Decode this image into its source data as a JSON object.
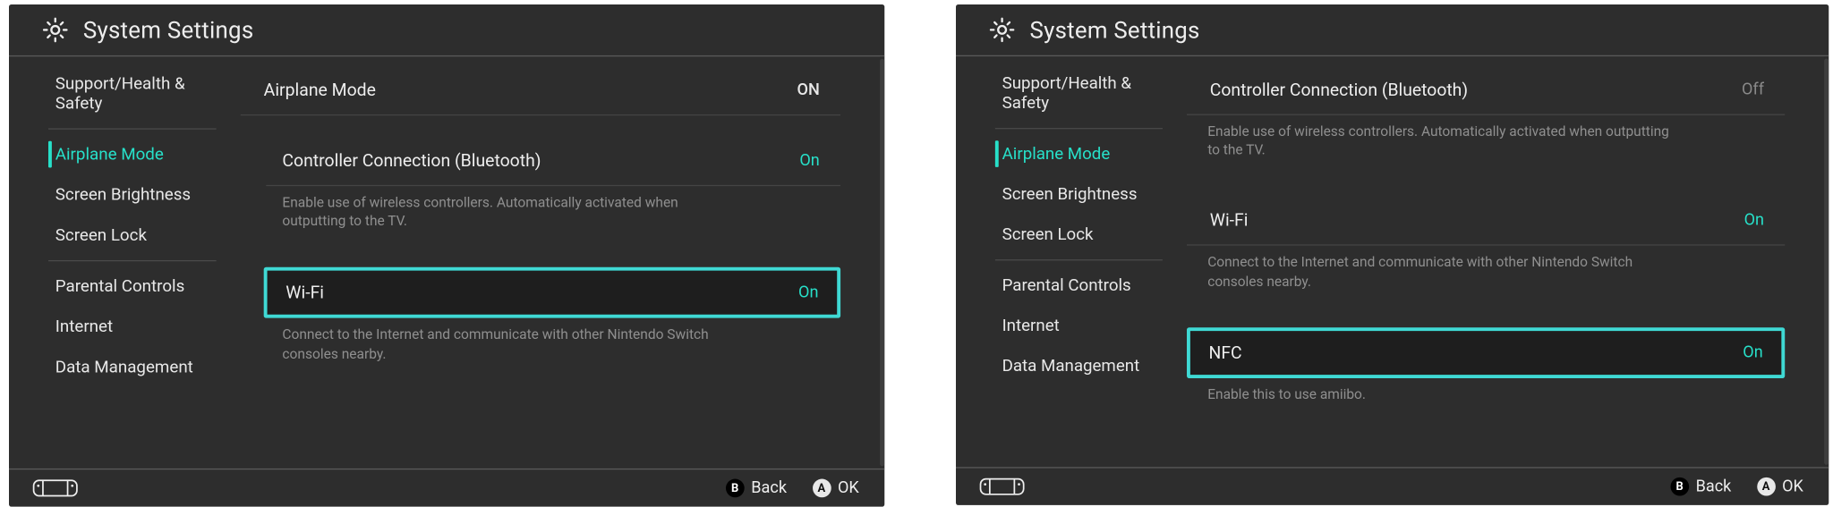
{
  "screens": [
    {
      "title": "System Settings",
      "sidebar": {
        "groups": [
          [
            "Support/Health & Safety"
          ],
          [
            "Airplane Mode",
            "Screen Brightness",
            "Screen Lock"
          ],
          [
            "Parental Controls",
            "Internet",
            "Data Management"
          ]
        ],
        "selected": "Airplane Mode"
      },
      "main": [
        {
          "kind": "row",
          "label": "Airplane Mode",
          "status": "ON",
          "statusStyle": "on-white",
          "sub": false
        },
        {
          "kind": "spacer"
        },
        {
          "kind": "row",
          "label": "Controller Connection (Bluetooth)",
          "status": "On",
          "statusStyle": "on-green",
          "sub": true
        },
        {
          "kind": "desc",
          "text": "Enable use of wireless controllers. Automatically activated when outputting to the TV."
        },
        {
          "kind": "spacer"
        },
        {
          "kind": "highlight",
          "label": "Wi-Fi",
          "status": "On",
          "statusStyle": "on-green"
        },
        {
          "kind": "desc",
          "text": "Connect to the Internet and communicate with other Nintendo Switch consoles nearby."
        }
      ],
      "footer": {
        "back": "Back",
        "ok": "OK"
      }
    },
    {
      "title": "System Settings",
      "sidebar": {
        "groups": [
          [
            "Support/Health & Safety"
          ],
          [
            "Airplane Mode",
            "Screen Brightness",
            "Screen Lock"
          ],
          [
            "Parental Controls",
            "Internet",
            "Data Management"
          ]
        ],
        "selected": "Airplane Mode"
      },
      "main": [
        {
          "kind": "row",
          "label": "Controller Connection (Bluetooth)",
          "status": "Off",
          "statusStyle": "off-grey",
          "sub": false
        },
        {
          "kind": "desc",
          "text": "Enable use of wireless controllers. Automatically activated when outputting to the TV.",
          "noindent": true
        },
        {
          "kind": "spacer"
        },
        {
          "kind": "row",
          "label": "Wi-Fi",
          "status": "On",
          "statusStyle": "on-green",
          "sub": false
        },
        {
          "kind": "desc",
          "text": "Connect to the Internet and communicate with other Nintendo Switch consoles nearby.",
          "noindent": true
        },
        {
          "kind": "spacer"
        },
        {
          "kind": "highlight",
          "label": "NFC",
          "status": "On",
          "statusStyle": "on-green",
          "noindentHL": true
        },
        {
          "kind": "desc",
          "text": "Enable this to use amiibo.",
          "noindent": true
        }
      ],
      "footer": {
        "back": "Back",
        "ok": "OK"
      }
    }
  ]
}
